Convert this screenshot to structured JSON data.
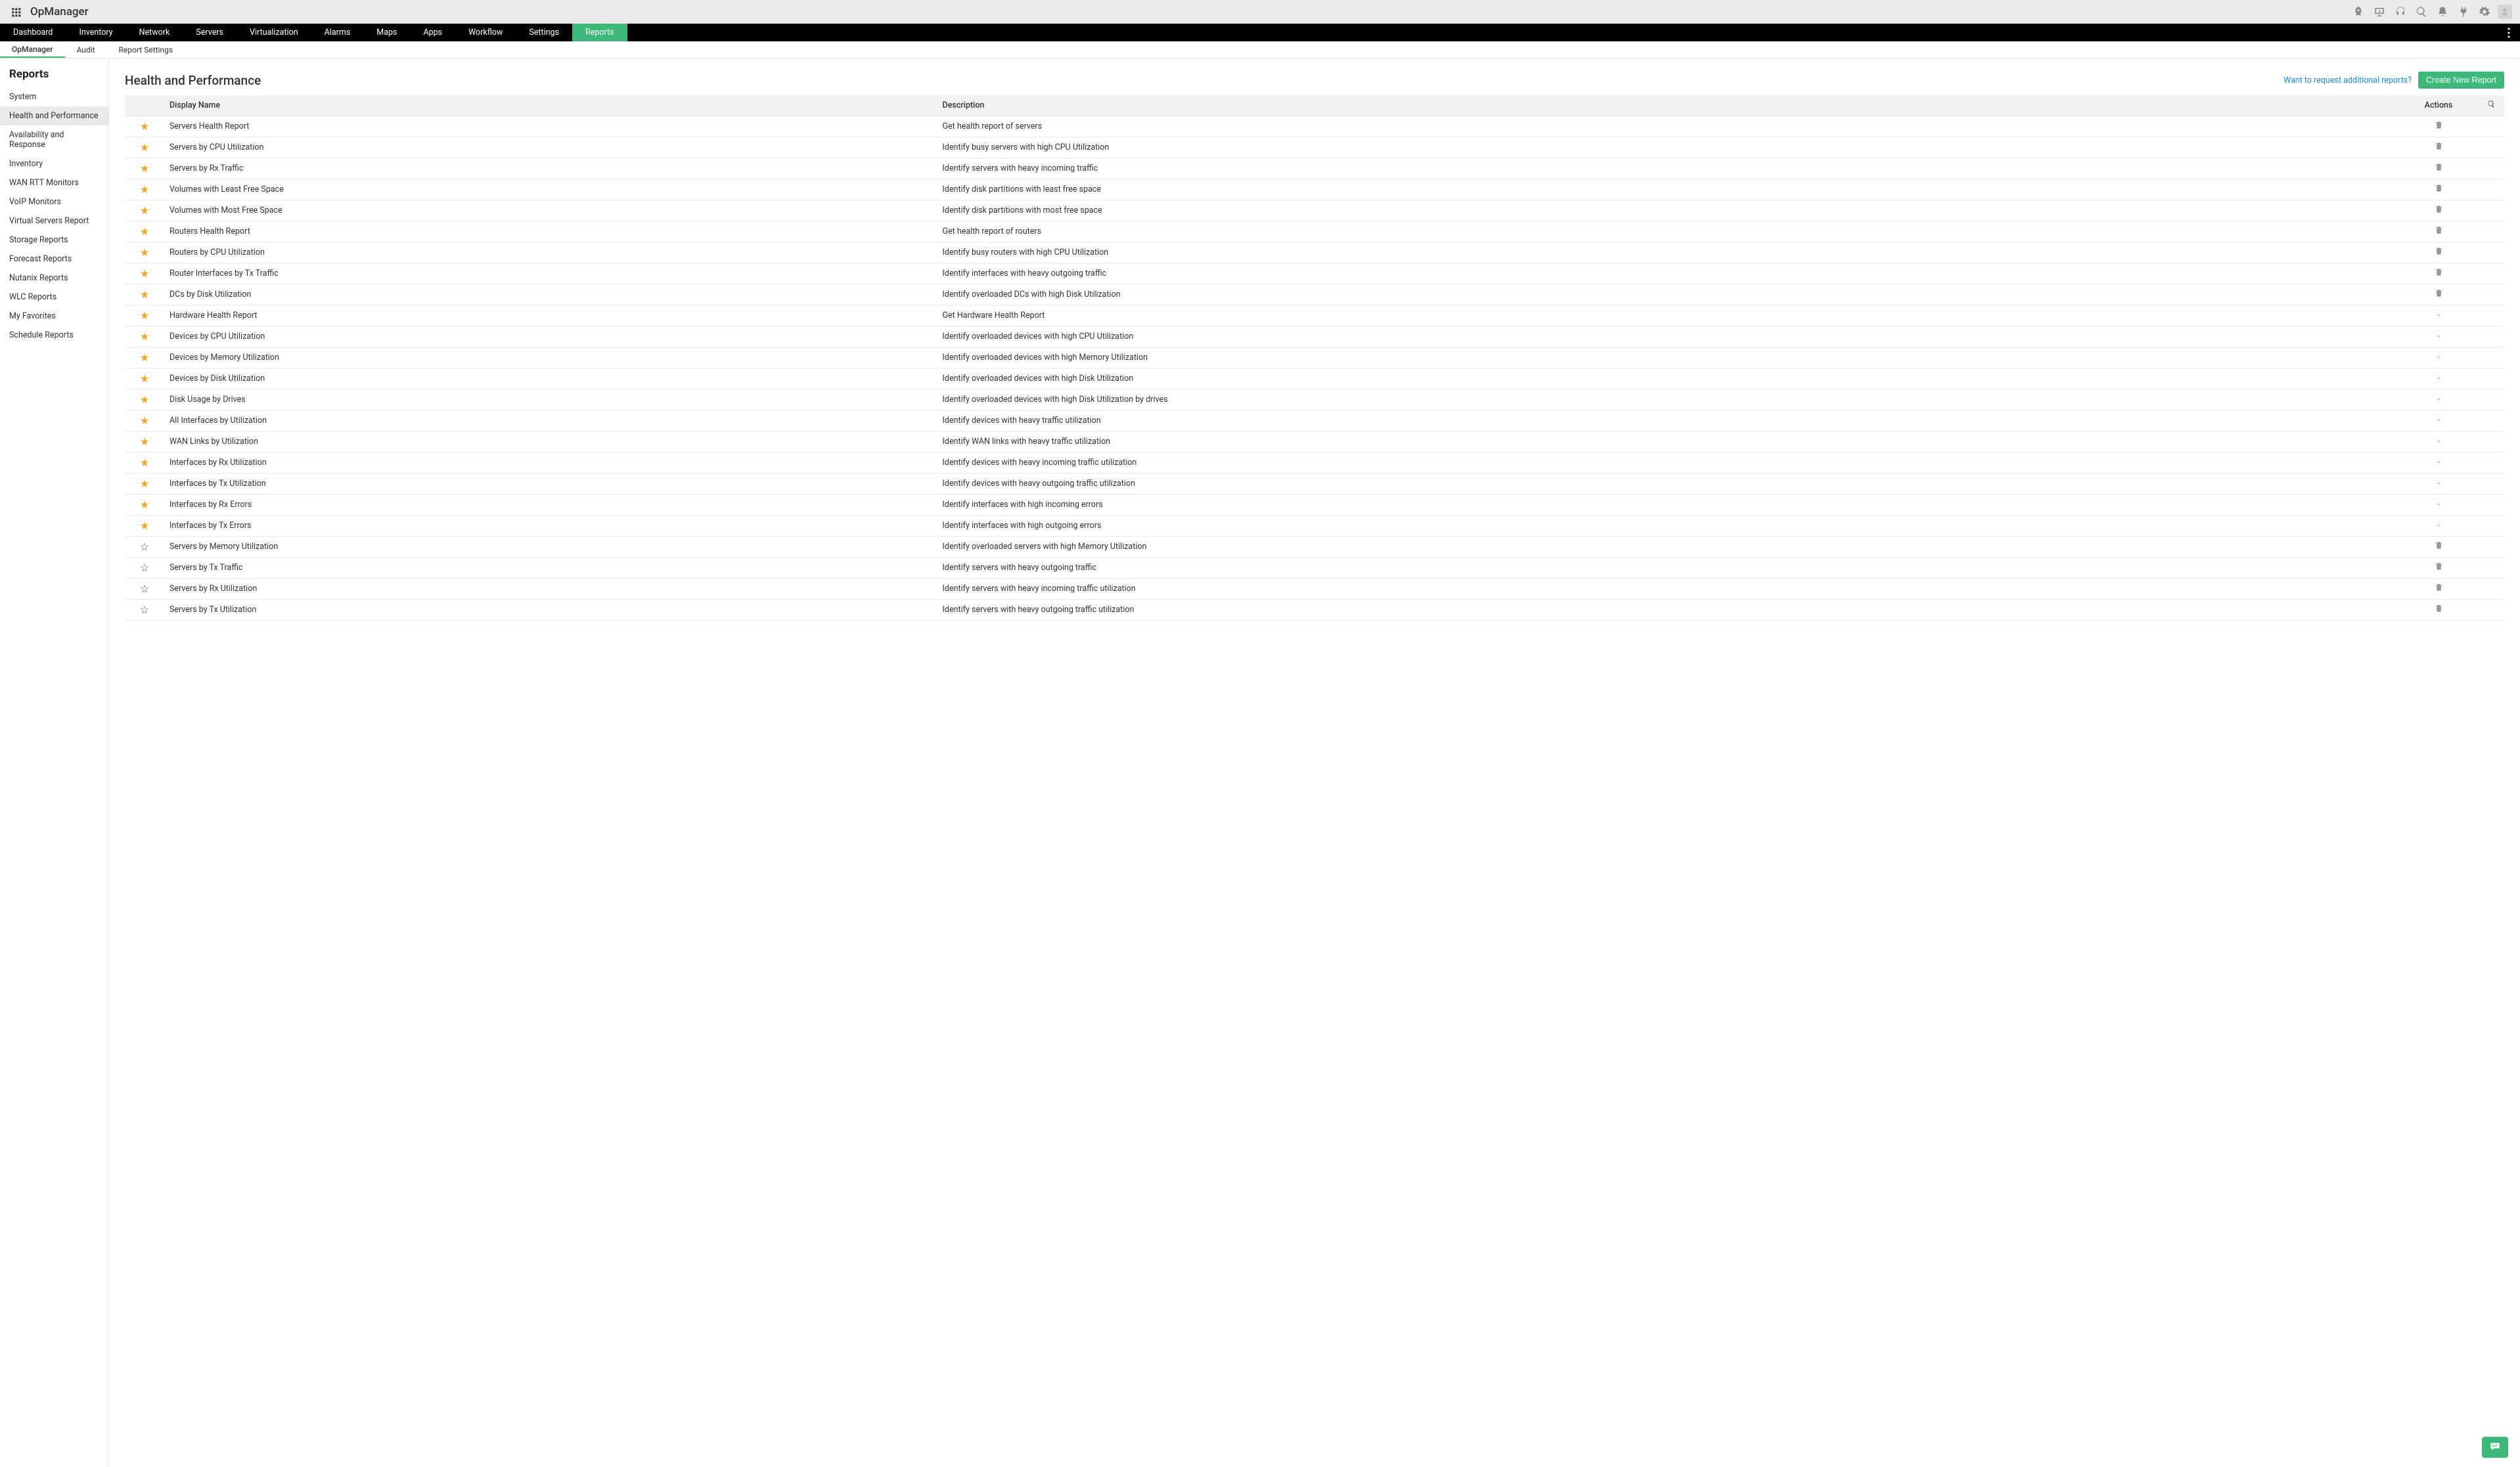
{
  "brand": "OpManager",
  "nav_main": {
    "items": [
      "Dashboard",
      "Inventory",
      "Network",
      "Servers",
      "Virtualization",
      "Alarms",
      "Maps",
      "Apps",
      "Workflow",
      "Settings",
      "Reports"
    ],
    "active": "Reports"
  },
  "nav_sub": {
    "items": [
      "OpManager",
      "Audit",
      "Report Settings"
    ],
    "active": "OpManager"
  },
  "sidebar": {
    "title": "Reports",
    "items": [
      "System",
      "Health and Performance",
      "Availability and Response",
      "Inventory",
      "WAN RTT Monitors",
      "VoIP Monitors",
      "Virtual Servers Report",
      "Storage Reports",
      "Forecast Reports",
      "Nutanix Reports",
      "WLC Reports",
      "My Favorites",
      "Schedule Reports"
    ],
    "active": "Health and Performance"
  },
  "page": {
    "title": "Health and Performance",
    "request_link": "Want to request additional reports?",
    "create_btn": "Create New Report"
  },
  "table": {
    "headers": {
      "display_name": "Display Name",
      "description": "Description",
      "actions": "Actions"
    },
    "rows": [
      {
        "fav": true,
        "name": "Servers Health Report",
        "desc": "Get health report of servers",
        "del": true
      },
      {
        "fav": true,
        "name": "Servers by CPU Utilization",
        "desc": "Identify busy servers with high CPU Utilization",
        "del": true
      },
      {
        "fav": true,
        "name": "Servers by Rx Traffic",
        "desc": "Identify servers with heavy incoming traffic",
        "del": true
      },
      {
        "fav": true,
        "name": "Volumes with Least Free Space",
        "desc": "Identify disk partitions with least free space",
        "del": true
      },
      {
        "fav": true,
        "name": "Volumes with Most Free Space",
        "desc": "Identify disk partitions with most free space",
        "del": true
      },
      {
        "fav": true,
        "name": "Routers Health Report",
        "desc": "Get health report of routers",
        "del": true
      },
      {
        "fav": true,
        "name": "Routers by CPU Utilization",
        "desc": "Identify busy routers with high CPU Utilization",
        "del": true
      },
      {
        "fav": true,
        "name": "Router Interfaces by Tx Traffic",
        "desc": "Identify interfaces with heavy outgoing traffic",
        "del": true
      },
      {
        "fav": true,
        "name": "DCs by Disk Utilization",
        "desc": "Identify overloaded DCs with high Disk Utilization",
        "del": true
      },
      {
        "fav": true,
        "name": "Hardware Health Report",
        "desc": "Get Hardware Health Report",
        "del": false
      },
      {
        "fav": true,
        "name": "Devices by CPU Utilization",
        "desc": "Identify overloaded devices with high CPU Utilization",
        "del": false
      },
      {
        "fav": true,
        "name": "Devices by Memory Utilization",
        "desc": "Identify overloaded devices with high Memory Utilization",
        "del": false
      },
      {
        "fav": true,
        "name": "Devices by Disk Utilization",
        "desc": "Identify overloaded devices with high Disk Utilization",
        "del": false
      },
      {
        "fav": true,
        "name": "Disk Usage by Drives",
        "desc": "Identify overloaded devices with high Disk Utilization by drives",
        "del": false
      },
      {
        "fav": true,
        "name": "All Interfaces by Utilization",
        "desc": "Identify devices with heavy traffic utilization",
        "del": false
      },
      {
        "fav": true,
        "name": "WAN Links by Utilization",
        "desc": "Identify WAN links with heavy traffic utilization",
        "del": false
      },
      {
        "fav": true,
        "name": "Interfaces by Rx Utilization",
        "desc": "Identify devices with heavy incoming traffic utilization",
        "del": false
      },
      {
        "fav": true,
        "name": "Interfaces by Tx Utilization",
        "desc": "Identify devices with heavy outgoing traffic utilization",
        "del": false
      },
      {
        "fav": true,
        "name": "Interfaces by Rx Errors",
        "desc": "Identify interfaces with high incoming errors",
        "del": false
      },
      {
        "fav": true,
        "name": "Interfaces by Tx Errors",
        "desc": "Identify interfaces with high outgoing errors",
        "del": false
      },
      {
        "fav": false,
        "name": "Servers by Memory Utilization",
        "desc": "Identify overloaded servers with high Memory Utilization",
        "del": true
      },
      {
        "fav": false,
        "name": "Servers by Tx Traffic",
        "desc": "Identify servers with heavy outgoing traffic",
        "del": true
      },
      {
        "fav": false,
        "name": "Servers by Rx Utilization",
        "desc": "Identify servers with heavy incoming traffic utilization",
        "del": true
      },
      {
        "fav": false,
        "name": "Servers by Tx Utilization",
        "desc": "Identify servers with heavy outgoing traffic utilization",
        "del": true
      }
    ]
  }
}
